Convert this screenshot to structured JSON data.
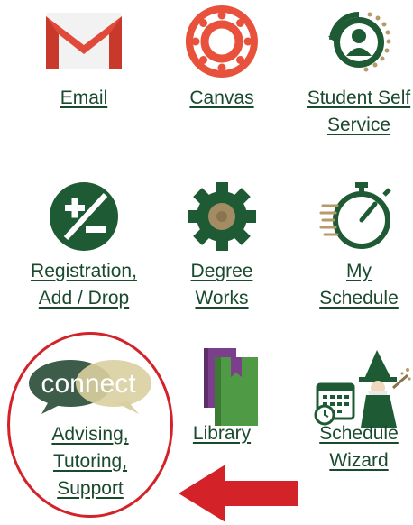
{
  "tiles": [
    {
      "id": "email",
      "label_lines": [
        "Email"
      ],
      "icon": "gmail-icon"
    },
    {
      "id": "canvas",
      "label_lines": [
        "Canvas"
      ],
      "icon": "canvas-icon"
    },
    {
      "id": "student-self-service",
      "label_lines": [
        "Student Self",
        "Service"
      ],
      "icon": "student-self-service-icon"
    },
    {
      "id": "registration",
      "label_lines": [
        "Registration,",
        "Add / Drop"
      ],
      "icon": "plus-minus-icon"
    },
    {
      "id": "degree-works",
      "label_lines": [
        "Degree",
        "Works"
      ],
      "icon": "gear-icon"
    },
    {
      "id": "my-schedule",
      "label_lines": [
        "My",
        "Schedule"
      ],
      "icon": "stopwatch-icon"
    },
    {
      "id": "connect",
      "label_lines": [
        "Advising,",
        "Tutoring,",
        "Support"
      ],
      "icon": "connect-logo",
      "logo_text": "connect"
    },
    {
      "id": "library",
      "label_lines": [
        "Library"
      ],
      "icon": "books-icon"
    },
    {
      "id": "schedule-wizard",
      "label_lines": [
        "Schedule",
        "Wizard"
      ],
      "icon": "wizard-icon"
    }
  ],
  "colors": {
    "link": "#1a4a2e",
    "brand_green": "#1e5b34",
    "annotation": "#d42229"
  }
}
